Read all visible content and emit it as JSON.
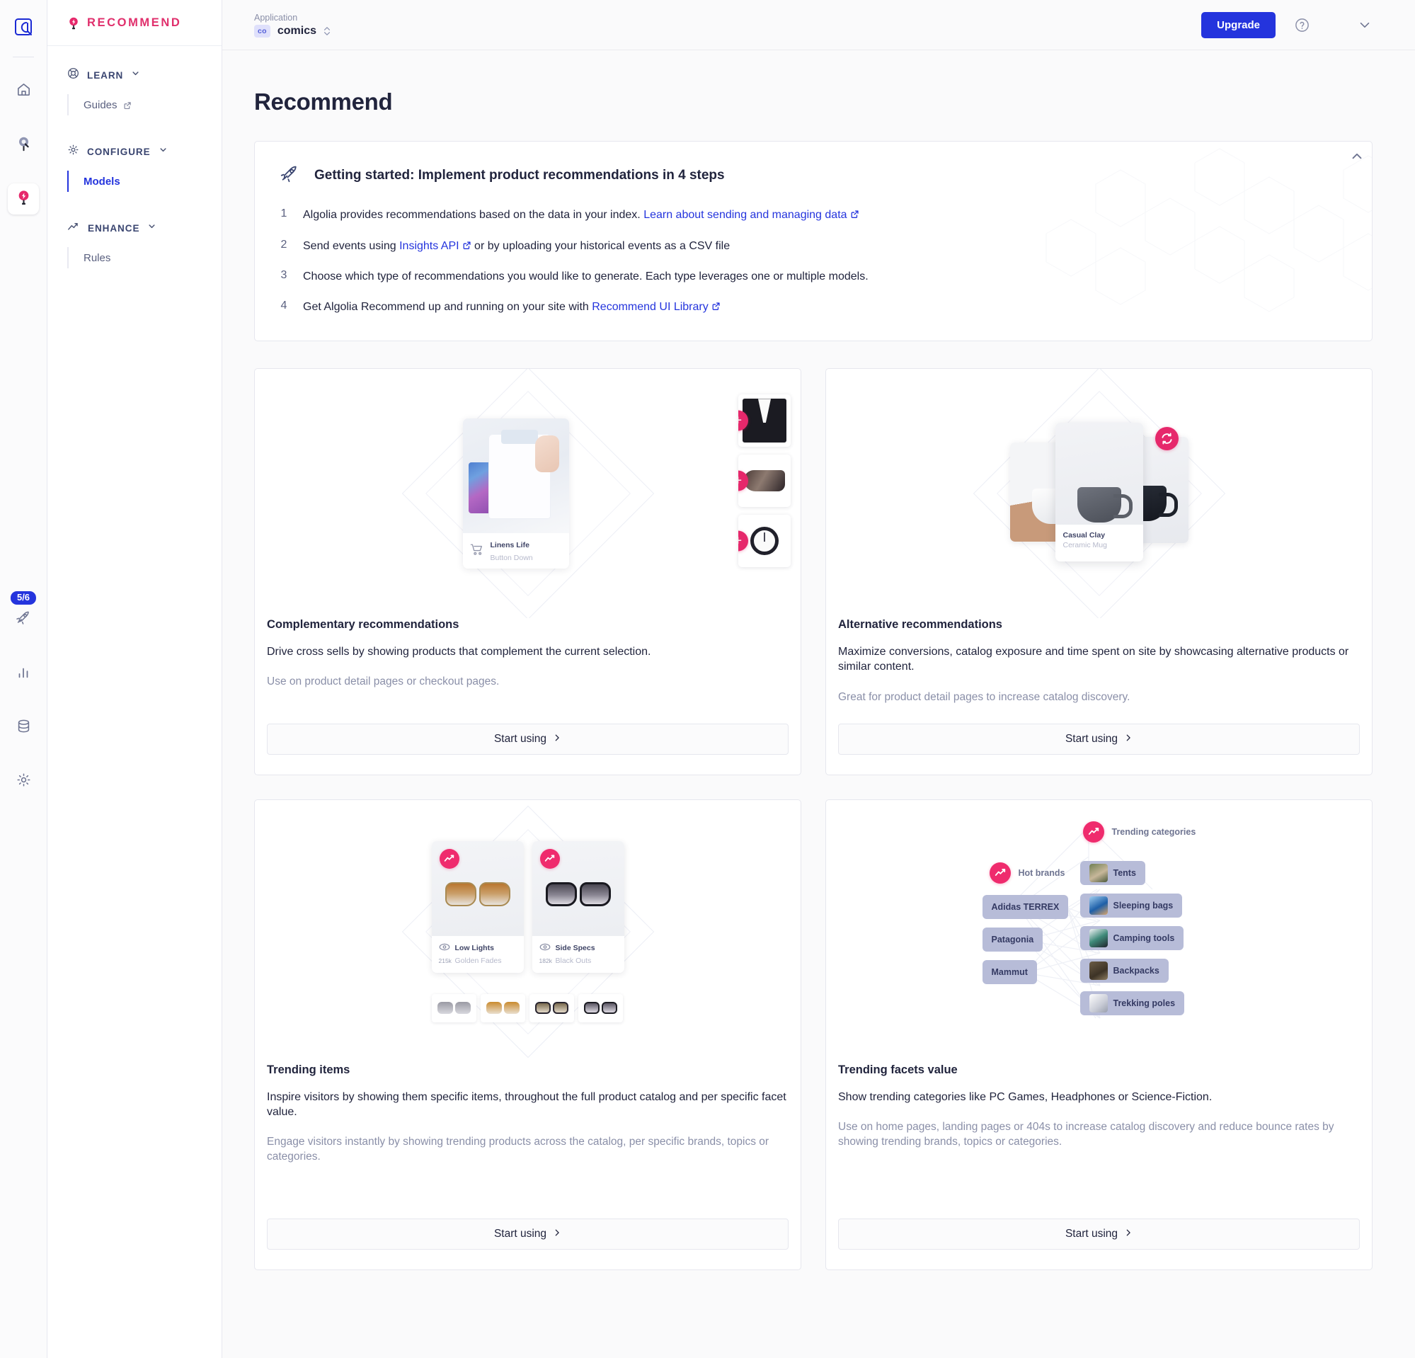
{
  "rail": {
    "logo_icon": "algolia-logo-icon",
    "items": [
      {
        "icon": "home-icon",
        "name": "home",
        "active": false
      },
      {
        "icon": "search-pin-icon",
        "name": "search",
        "active": false
      },
      {
        "icon": "recommend-pin-icon",
        "name": "recommend",
        "active": true
      },
      {
        "icon": "rocket-icon",
        "name": "getting-started",
        "badge": "5/6",
        "active": false
      },
      {
        "icon": "bar-chart-icon",
        "name": "analytics",
        "active": false
      },
      {
        "icon": "database-icon",
        "name": "data-sources",
        "active": false
      },
      {
        "icon": "gear-icon",
        "name": "settings",
        "active": false
      }
    ]
  },
  "sidebar": {
    "brand": "RECOMMEND",
    "brand_icon": "recommend-pin-icon",
    "brand_color": "#e02f6c",
    "groups": [
      {
        "label": "LEARN",
        "icon": "lifebuoy-icon",
        "items": [
          {
            "label": "Guides",
            "external": true,
            "current": false
          }
        ]
      },
      {
        "label": "CONFIGURE",
        "icon": "gear-icon",
        "items": [
          {
            "label": "Models",
            "external": false,
            "current": true
          }
        ]
      },
      {
        "label": "ENHANCE",
        "icon": "trend-up-icon",
        "items": [
          {
            "label": "Rules",
            "external": false,
            "current": false
          }
        ]
      }
    ]
  },
  "topbar": {
    "application_label": "Application",
    "application_chip": "co",
    "application_name": "comics",
    "upgrade_label": "Upgrade",
    "help_icon": "question-circle-icon",
    "account_icon": "chevron-down-icon"
  },
  "page": {
    "title": "Recommend"
  },
  "getting_started": {
    "icon": "rocket-icon",
    "title": "Getting started: Implement product recommendations in 4 steps",
    "collapse_icon": "chevron-up-icon",
    "steps": [
      {
        "num": "1",
        "before": "Algolia provides recommendations based on the data in your index. ",
        "link": "Learn about sending and managing data",
        "after": "",
        "external": true
      },
      {
        "num": "2",
        "before": "Send events using ",
        "link": "Insights API",
        "after": " or by uploading your historical events as a CSV file",
        "external": true
      },
      {
        "num": "3",
        "before": "Choose which type of recommendations you would like to generate. Each type leverages one or multiple models.",
        "link": "",
        "after": "",
        "external": false
      },
      {
        "num": "4",
        "before": "Get Algolia Recommend up and running on your site with ",
        "link": "Recommend UI Library",
        "after": "",
        "external": true
      }
    ]
  },
  "models": [
    {
      "name": "complementary",
      "title": "Complementary recommendations",
      "description": "Drive cross sells by showing products that complement the current selection.",
      "hint": "Use on product detail pages or checkout pages.",
      "cta": "Start using",
      "art": {
        "kind": "complementary",
        "product_name": "Linens Life",
        "product_sub": "Button Down",
        "badge_icon": "plus-icon",
        "thumbs": [
          "suit",
          "shoe",
          "watch"
        ]
      }
    },
    {
      "name": "alternative",
      "title": "Alternative recommendations",
      "description": "Maximize conversions, catalog exposure and time spent on site by showcasing alternative products or similar content.",
      "hint": "Great for product detail pages to increase catalog discovery.",
      "cta": "Start using",
      "art": {
        "kind": "alternative",
        "product_name": "Casual Clay",
        "product_sub": "Ceramic Mug",
        "badge_icon": "refresh-icon"
      }
    },
    {
      "name": "trending-items",
      "title": "Trending items",
      "description": "Inspire visitors by showing them specific items, throughout the full product catalog and per specific facet value.",
      "hint": "Engage visitors instantly by showing trending products across the catalog, per specific brands, topics or categories.",
      "cta": "Start using",
      "art": {
        "kind": "trending-items",
        "badge_icon": "trend-up-icon",
        "items": [
          {
            "name": "Low Lights",
            "sub": "Golden Fades",
            "count": "215k"
          },
          {
            "name": "Side Specs",
            "sub": "Black Outs",
            "count": "182k"
          }
        ]
      }
    },
    {
      "name": "trending-facets-value",
      "title": "Trending facets value",
      "description": "Show trending categories like PC Games, Headphones or Science-Fiction.",
      "hint": "Use on home pages, landing pages or 404s to increase catalog discovery and reduce bounce rates by showing trending brands, topics or categories.",
      "cta": "Start using",
      "art": {
        "kind": "trending-facets",
        "badge_icon": "trend-up-icon",
        "categories_label": "Trending categories",
        "brands_label": "Hot brands",
        "brands": [
          "Adidas TERREX",
          "Patagonia",
          "Mammut"
        ],
        "categories": [
          "Tents",
          "Sleeping bags",
          "Camping tools",
          "Backpacks",
          "Trekking poles"
        ]
      }
    }
  ],
  "colors": {
    "accent_blue": "#2434dd",
    "brand_pink": "#e02f6c",
    "pill_purple": "#b7bcd8",
    "muted_text": "#8a8fa8"
  }
}
